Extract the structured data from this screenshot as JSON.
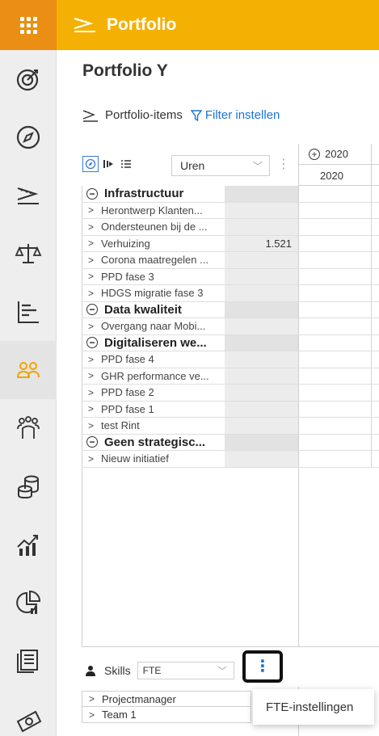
{
  "app": {
    "title": "Portfolio"
  },
  "page": {
    "title": "Portfolio Y"
  },
  "section": {
    "label": "Portfolio-items",
    "filter_label": "Filter instellen"
  },
  "toolbar": {
    "unit_value": "Uren"
  },
  "timeline": {
    "year_top": "2020",
    "year_sub": "2020"
  },
  "rows": [
    {
      "type": "group",
      "label": "Infrastructuur",
      "value": ""
    },
    {
      "type": "item",
      "label": "Herontwerp Klanten...",
      "value": ""
    },
    {
      "type": "item",
      "label": "Ondersteunen bij de ...",
      "value": ""
    },
    {
      "type": "item",
      "label": "Verhuizing",
      "value": "1.521"
    },
    {
      "type": "item",
      "label": "Corona maatregelen ...",
      "value": ""
    },
    {
      "type": "item",
      "label": "PPD fase 3",
      "value": ""
    },
    {
      "type": "item",
      "label": "HDGS migratie fase 3",
      "value": ""
    },
    {
      "type": "group",
      "label": "Data kwaliteit",
      "value": ""
    },
    {
      "type": "item",
      "label": "Overgang naar Mobi...",
      "value": ""
    },
    {
      "type": "group",
      "label": "Digitaliseren we...",
      "value": ""
    },
    {
      "type": "item",
      "label": "PPD fase 4",
      "value": ""
    },
    {
      "type": "item",
      "label": "GHR performance ve...",
      "value": ""
    },
    {
      "type": "item",
      "label": "PPD fase 2",
      "value": ""
    },
    {
      "type": "item",
      "label": "PPD fase 1",
      "value": ""
    },
    {
      "type": "item",
      "label": "test Rint",
      "value": ""
    },
    {
      "type": "group",
      "label": "Geen strategisc...",
      "value": ""
    },
    {
      "type": "item",
      "label": "Nieuw initiatief",
      "value": ""
    }
  ],
  "skills": {
    "label": "Skills",
    "unit_value": "FTE",
    "rows": [
      "Projectmanager",
      "Team 1"
    ],
    "menu_item": "FTE-instellingen"
  },
  "rail": {
    "icons": [
      "target-icon",
      "compass-icon",
      "portfolio-icon",
      "balance-icon",
      "gantt-icon",
      "people-icon",
      "team-icon",
      "coins-icon",
      "growth-chart-icon",
      "pie-chart-icon",
      "document-list-icon",
      "money-icon"
    ],
    "active": "people-icon"
  },
  "colors": {
    "topbar": "#f4b103",
    "apps": "#ea8f14",
    "link": "#1a73d9",
    "active_rail_icon": "#f0a500"
  }
}
